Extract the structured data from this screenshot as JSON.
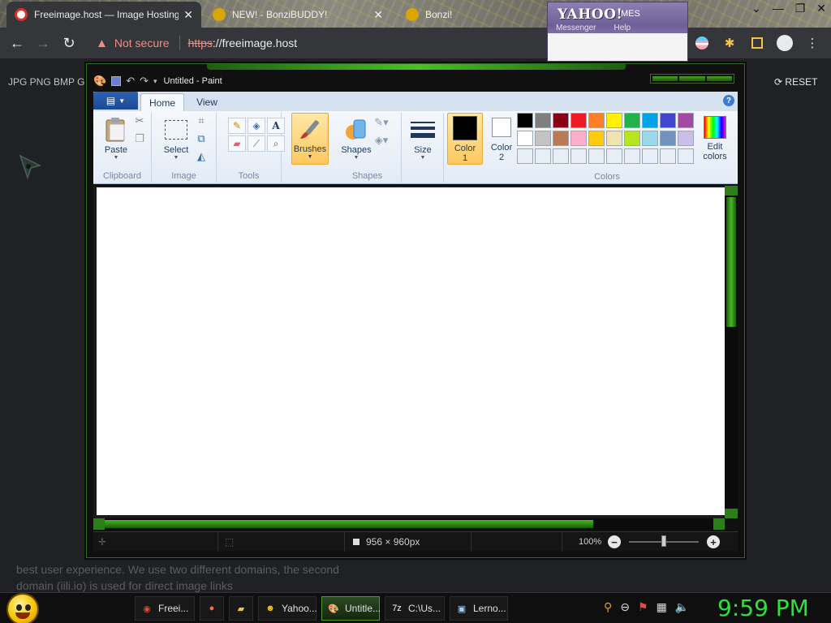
{
  "browser": {
    "tabs": [
      {
        "title": "Freeimage.host — Image Hosting",
        "active": true,
        "favicon_color": "#d93025"
      },
      {
        "title": "NEW! - BonziBUDDY!",
        "active": false,
        "favicon_color": "#d9a600"
      },
      {
        "title": "Bonzi!",
        "active": false,
        "favicon_color": "#d9a600"
      }
    ],
    "security_label": "Not secure",
    "url_scheme": "https",
    "url_rest": "://freeimage.host"
  },
  "yahoo": {
    "logo": "YAHOO!",
    "logo_suffix": "MES",
    "menu": [
      "Messenger",
      "Help"
    ]
  },
  "page": {
    "formats": "JPG PNG BMP G",
    "reset_label": "RESET",
    "footer_text": "best user experience. We use two different domains, the second domain (iili.io) is used for direct image links"
  },
  "paint": {
    "title": "Untitled - Paint",
    "tabs": [
      "Home",
      "View"
    ],
    "groups": {
      "clipboard": "Clipboard",
      "image": "Image",
      "tools": "Tools",
      "shapes": "Shapes",
      "colors": "Colors"
    },
    "buttons": {
      "paste": "Paste",
      "select": "Select",
      "brushes": "Brushes",
      "shapes": "Shapes",
      "size": "Size",
      "color1_a": "Color",
      "color1_b": "1",
      "color2_a": "Color",
      "color2_b": "2",
      "edit_a": "Edit",
      "edit_b": "colors"
    },
    "palette_row1": [
      "#000000",
      "#7f7f7f",
      "#880015",
      "#ed1c24",
      "#ff7f27",
      "#fff200",
      "#22b14c",
      "#00a2e8",
      "#3f48cc",
      "#a349a4"
    ],
    "palette_row2": [
      "#ffffff",
      "#c3c3c3",
      "#b97a57",
      "#ffaec9",
      "#ffc90e",
      "#efe4b0",
      "#b5e61d",
      "#99d9ea",
      "#7092be",
      "#c8bfe7"
    ],
    "palette_row3": [
      "#e8eef6",
      "#e8eef6",
      "#e8eef6",
      "#e8eef6",
      "#e8eef6",
      "#e8eef6",
      "#e8eef6",
      "#e8eef6",
      "#e8eef6",
      "#e8eef6"
    ],
    "status": {
      "dimensions": "956 × 960px",
      "zoom": "100%"
    }
  },
  "taskbar": {
    "items": [
      {
        "label": "Freei...",
        "icon": "chrome-icon",
        "color": "#dd4b39"
      },
      {
        "label": "",
        "icon": "firefox-icon",
        "color": "#ff7139"
      },
      {
        "label": "",
        "icon": "folder-icon",
        "color": "#f3c443"
      },
      {
        "label": "Yahoo...",
        "icon": "yahoo-smiley-icon",
        "color": "#f7c400"
      },
      {
        "label": "Untitle...",
        "icon": "paint-icon",
        "color": "#6aa5e0"
      },
      {
        "label": "C:\\Us...",
        "icon": "7zip-icon",
        "color": "#ffffff"
      },
      {
        "label": "Lerno...",
        "icon": "app-icon",
        "color": "#9ad1ff"
      }
    ],
    "clock": "9:59 PM"
  }
}
